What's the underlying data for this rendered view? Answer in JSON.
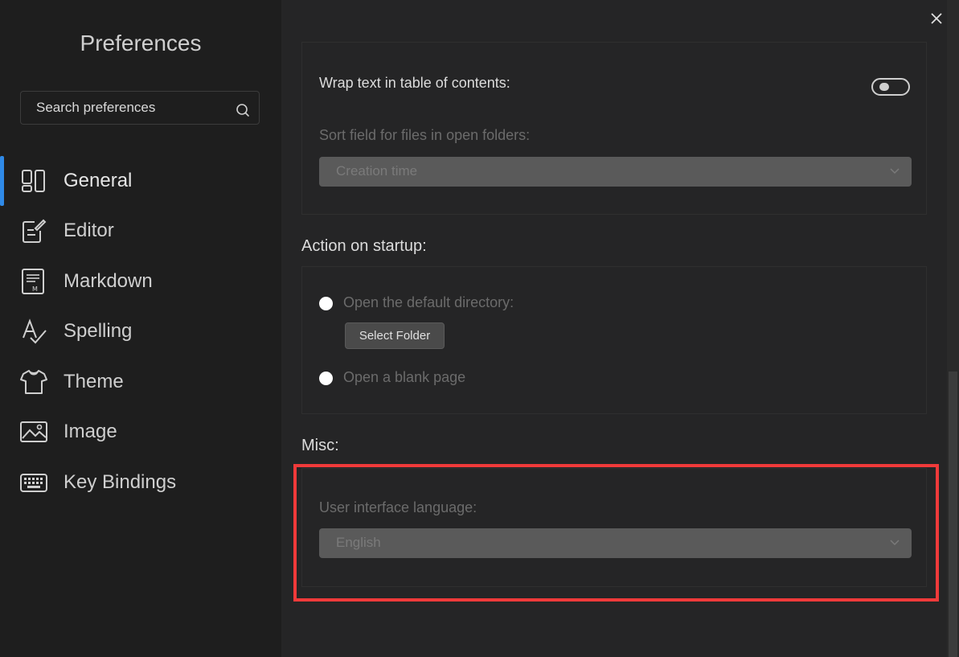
{
  "sidebar": {
    "title": "Preferences",
    "search_placeholder": "Search preferences",
    "items": [
      {
        "label": "General",
        "icon": "layout-icon"
      },
      {
        "label": "Editor",
        "icon": "edit-icon"
      },
      {
        "label": "Markdown",
        "icon": "markdown-icon"
      },
      {
        "label": "Spelling",
        "icon": "spelling-icon"
      },
      {
        "label": "Theme",
        "icon": "shirt-icon"
      },
      {
        "label": "Image",
        "icon": "image-icon"
      },
      {
        "label": "Key Bindings",
        "icon": "keyboard-icon"
      }
    ],
    "active_item": "General"
  },
  "main": {
    "sidebar_panel": {
      "wrap_toc_label": "Wrap text in table of contents:",
      "wrap_toc_enabled": false,
      "sort_field_label": "Sort field for files in open folders:",
      "sort_field_value": "Creation time"
    },
    "startup": {
      "title": "Action on startup:",
      "open_default_label": "Open the default directory:",
      "select_folder_label": "Select Folder",
      "open_blank_label": "Open a blank page"
    },
    "misc": {
      "title": "Misc:",
      "language_label": "User interface language:",
      "language_value": "English"
    }
  },
  "colors": {
    "accent": "#2f8ae8",
    "highlight": "#f03a3a"
  }
}
